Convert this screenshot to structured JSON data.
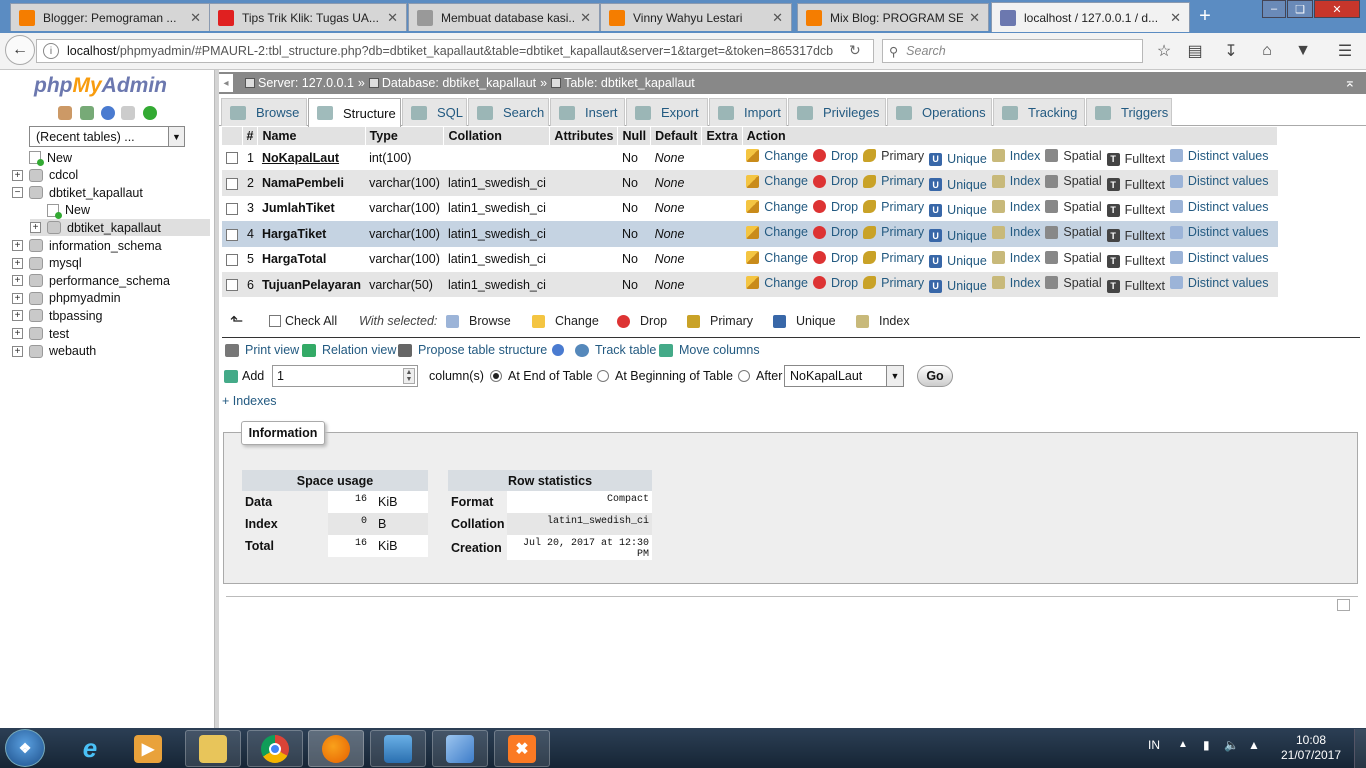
{
  "browser": {
    "tabs": [
      {
        "label": "Blogger: Pemograman ...",
        "icon": "blogger-icon",
        "color": "#f57d00"
      },
      {
        "label": "Tips Trik Klik: Tugas UA...",
        "icon": "heart-icon",
        "color": "#e02020"
      },
      {
        "label": "Membuat database kasi...",
        "icon": "globe-icon",
        "color": "#999999"
      },
      {
        "label": "Vinny Wahyu Lestari",
        "icon": "blogger-icon",
        "color": "#f57d00"
      },
      {
        "label": "Mix Blog: PROGRAM SE...",
        "icon": "blogger-icon",
        "color": "#f57d00"
      },
      {
        "label": "localhost / 127.0.0.1 / d...",
        "icon": "pma-icon",
        "color": "#6c78af"
      }
    ],
    "url_host": "localhost",
    "url_rest": "/phpmyadmin/#PMAURL-2:tbl_structure.php?db=dbtiket_kapallaut&table=dbtiket_kapallaut&server=1&target=&token=865317dcb",
    "search_placeholder": "Search"
  },
  "left": {
    "logo": {
      "php": "php",
      "my": "My",
      "admin": "Admin"
    },
    "recent_tables": "(Recent tables) ...",
    "tree": [
      {
        "label": "New",
        "type": "new",
        "indent": 0
      },
      {
        "label": "cdcol",
        "type": "db",
        "indent": 0
      },
      {
        "label": "dbtiket_kapallaut",
        "type": "db-open",
        "indent": 0
      },
      {
        "label": "New",
        "type": "new",
        "indent": 1
      },
      {
        "label": "dbtiket_kapallaut",
        "type": "table",
        "indent": 1
      },
      {
        "label": "information_schema",
        "type": "db",
        "indent": 0
      },
      {
        "label": "mysql",
        "type": "db",
        "indent": 0
      },
      {
        "label": "performance_schema",
        "type": "db",
        "indent": 0
      },
      {
        "label": "phpmyadmin",
        "type": "db",
        "indent": 0
      },
      {
        "label": "tbpassing",
        "type": "db",
        "indent": 0
      },
      {
        "label": "test",
        "type": "db",
        "indent": 0
      },
      {
        "label": "webauth",
        "type": "db",
        "indent": 0
      }
    ]
  },
  "breadcrumb": {
    "server": "Server: 127.0.0.1",
    "database": "Database: dbtiket_kapallaut",
    "table": "Table: dbtiket_kapallaut"
  },
  "menu_tabs": [
    "Browse",
    "Structure",
    "SQL",
    "Search",
    "Insert",
    "Export",
    "Import",
    "Privileges",
    "Operations",
    "Tracking",
    "Triggers"
  ],
  "structure": {
    "headers": [
      "#",
      "Name",
      "Type",
      "Collation",
      "Attributes",
      "Null",
      "Default",
      "Extra",
      "Action"
    ],
    "rows": [
      {
        "num": "1",
        "name": "NoKapalLaut",
        "type": "int(100)",
        "collation": "",
        "attributes": "",
        "null": "No",
        "default": "None",
        "extra": ""
      },
      {
        "num": "2",
        "name": "NamaPembeli",
        "type": "varchar(100)",
        "collation": "latin1_swedish_ci",
        "attributes": "",
        "null": "No",
        "default": "None",
        "extra": ""
      },
      {
        "num": "3",
        "name": "JumlahTiket",
        "type": "varchar(100)",
        "collation": "latin1_swedish_ci",
        "attributes": "",
        "null": "No",
        "default": "None",
        "extra": ""
      },
      {
        "num": "4",
        "name": "HargaTiket",
        "type": "varchar(100)",
        "collation": "latin1_swedish_ci",
        "attributes": "",
        "null": "No",
        "default": "None",
        "extra": ""
      },
      {
        "num": "5",
        "name": "HargaTotal",
        "type": "varchar(100)",
        "collation": "latin1_swedish_ci",
        "attributes": "",
        "null": "No",
        "default": "None",
        "extra": ""
      },
      {
        "num": "6",
        "name": "TujuanPelayaran",
        "type": "varchar(50)",
        "collation": "latin1_swedish_ci",
        "attributes": "",
        "null": "No",
        "default": "None",
        "extra": ""
      }
    ],
    "actions": [
      "Change",
      "Drop",
      "Primary",
      "Unique",
      "Index",
      "Spatial",
      "Fulltext",
      "Distinct values"
    ]
  },
  "with_selected": {
    "check_all": "Check All",
    "label": "With selected:",
    "buttons": [
      "Browse",
      "Change",
      "Drop",
      "Primary",
      "Unique",
      "Index"
    ]
  },
  "links": {
    "print_view": "Print view",
    "relation_view": "Relation view",
    "propose": "Propose table structure",
    "track": "Track table",
    "move": "Move columns"
  },
  "add_columns": {
    "label": "Add",
    "count": "1",
    "suffix": "column(s)",
    "opt_end": "At End of Table",
    "opt_begin": "At Beginning of Table",
    "opt_after": "After",
    "after_value": "NoKapalLaut",
    "go": "Go"
  },
  "indexes_link": "+ Indexes",
  "information": {
    "legend": "Information",
    "space_usage": {
      "caption": "Space usage",
      "rows": [
        {
          "label": "Data",
          "value": "16",
          "unit": "KiB"
        },
        {
          "label": "Index",
          "value": "0",
          "unit": "B"
        },
        {
          "label": "Total",
          "value": "16",
          "unit": "KiB"
        }
      ]
    },
    "row_statistics": {
      "caption": "Row statistics",
      "rows": [
        {
          "label": "Format",
          "value": "Compact"
        },
        {
          "label": "Collation",
          "value": "latin1_swedish_ci"
        },
        {
          "label": "Creation",
          "value": "Jul 20, 2017 at 12:30 PM"
        }
      ]
    }
  },
  "taskbar": {
    "tray_lang": "IN",
    "time": "10:08",
    "date": "21/07/2017"
  }
}
